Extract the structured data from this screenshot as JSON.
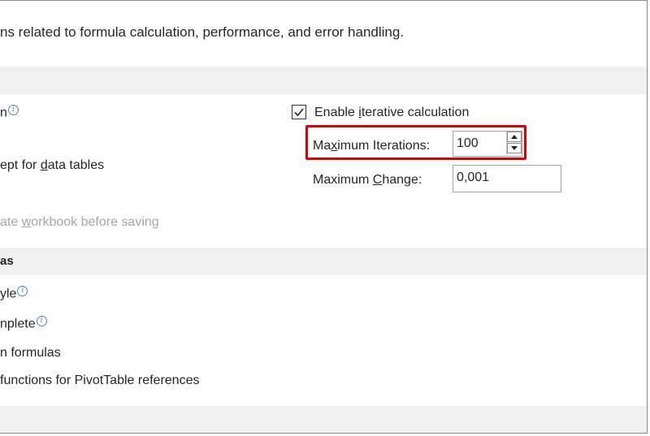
{
  "description": "ns related to formula calculation, performance, and error handling.",
  "calc_section": {
    "band_label": "",
    "workbook_calc_label": "n",
    "except_tables_pre": "ept for ",
    "except_tables_key": "d",
    "except_tables_post": "ata tables",
    "recalc_pre": "ate ",
    "recalc_key": "w",
    "recalc_post": "orkbook before saving",
    "iterative": {
      "checked": true,
      "label_pre": "Enable ",
      "label_key": "i",
      "label_post": "terative calculation"
    },
    "max_iterations": {
      "label_pre": "Ma",
      "label_key": "x",
      "label_post": "imum Iterations:",
      "value": "100"
    },
    "max_change": {
      "label_pre": "Maximum ",
      "label_key": "C",
      "label_post": "hange:",
      "value": "0,001"
    }
  },
  "formulas_section": {
    "band_label": "as",
    "r1c1_label": "yle",
    "autocomplete_label": "nplete",
    "table_names_label": "n formulas",
    "getpivot_label": " functions for PivotTable references"
  },
  "info_glyph": "i",
  "icons": [
    "info-icon",
    "checkmark-icon",
    "spin-up-icon",
    "spin-down-icon"
  ],
  "colors": {
    "highlight": "#e00000",
    "band": "#f0f0f0",
    "info": "#4a84c4"
  }
}
